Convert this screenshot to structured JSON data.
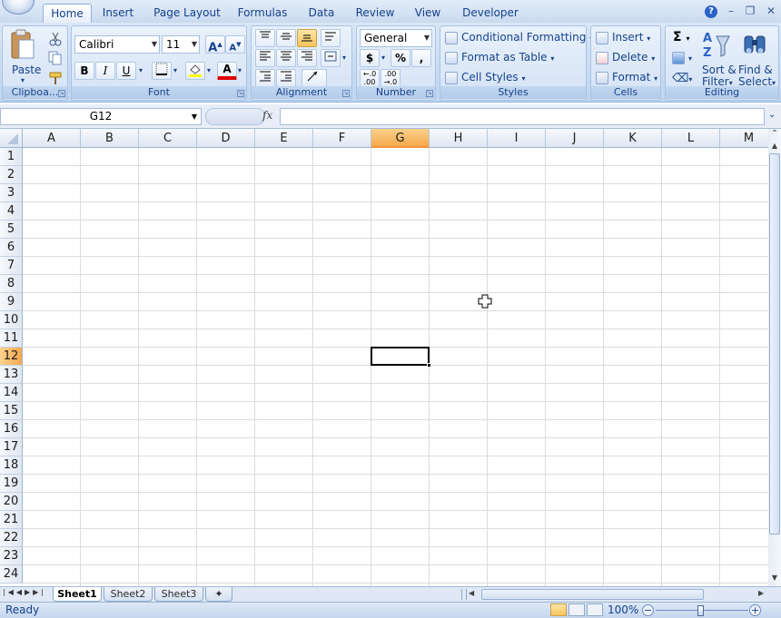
{
  "tabs": [
    "Home",
    "Insert",
    "Page Layout",
    "Formulas",
    "Data",
    "Review",
    "View",
    "Developer"
  ],
  "active_tab": "Home",
  "window_controls": {
    "help": "?",
    "minimize": "–",
    "restore": "❐",
    "close": "✕"
  },
  "clipboard": {
    "paste": "Paste",
    "label": "Clipboa..."
  },
  "font": {
    "name": "Calibri",
    "size": "11",
    "label": "Font",
    "grow": "A",
    "shrink": "A",
    "bold": "B",
    "italic": "I",
    "underline": "U",
    "font_color": "A"
  },
  "alignment": {
    "label": "Alignment"
  },
  "number": {
    "format": "General",
    "currency": "$",
    "percent": "%",
    "comma": ",",
    "inc_decimal": "←.0 .00",
    "dec_decimal": ".00 →.0",
    "label": "Number"
  },
  "styles": {
    "conditional": "Conditional Formatting",
    "format_table": "Format as Table",
    "cell_styles": "Cell Styles",
    "label": "Styles"
  },
  "cells": {
    "insert": "Insert",
    "delete": "Delete",
    "format": "Format",
    "label": "Cells"
  },
  "editing": {
    "sum": "Σ",
    "sort": "Sort &",
    "filter": "Filter",
    "find": "Find &",
    "select": "Select",
    "label": "Editing"
  },
  "formula_bar": {
    "name_box": "G12",
    "fx": "fx",
    "value": ""
  },
  "columns": [
    "A",
    "B",
    "C",
    "D",
    "E",
    "F",
    "G",
    "H",
    "I",
    "J",
    "K",
    "L",
    "M"
  ],
  "rows": [
    "1",
    "2",
    "3",
    "4",
    "5",
    "6",
    "7",
    "8",
    "9",
    "10",
    "11",
    "12",
    "13",
    "14",
    "15",
    "16",
    "17",
    "18",
    "19",
    "20",
    "21",
    "22",
    "23",
    "24"
  ],
  "selected_column": "G",
  "selected_row": "12",
  "sheets": [
    "Sheet1",
    "Sheet2",
    "Sheet3"
  ],
  "active_sheet": "Sheet1",
  "status": {
    "ready": "Ready",
    "zoom": "100%"
  }
}
